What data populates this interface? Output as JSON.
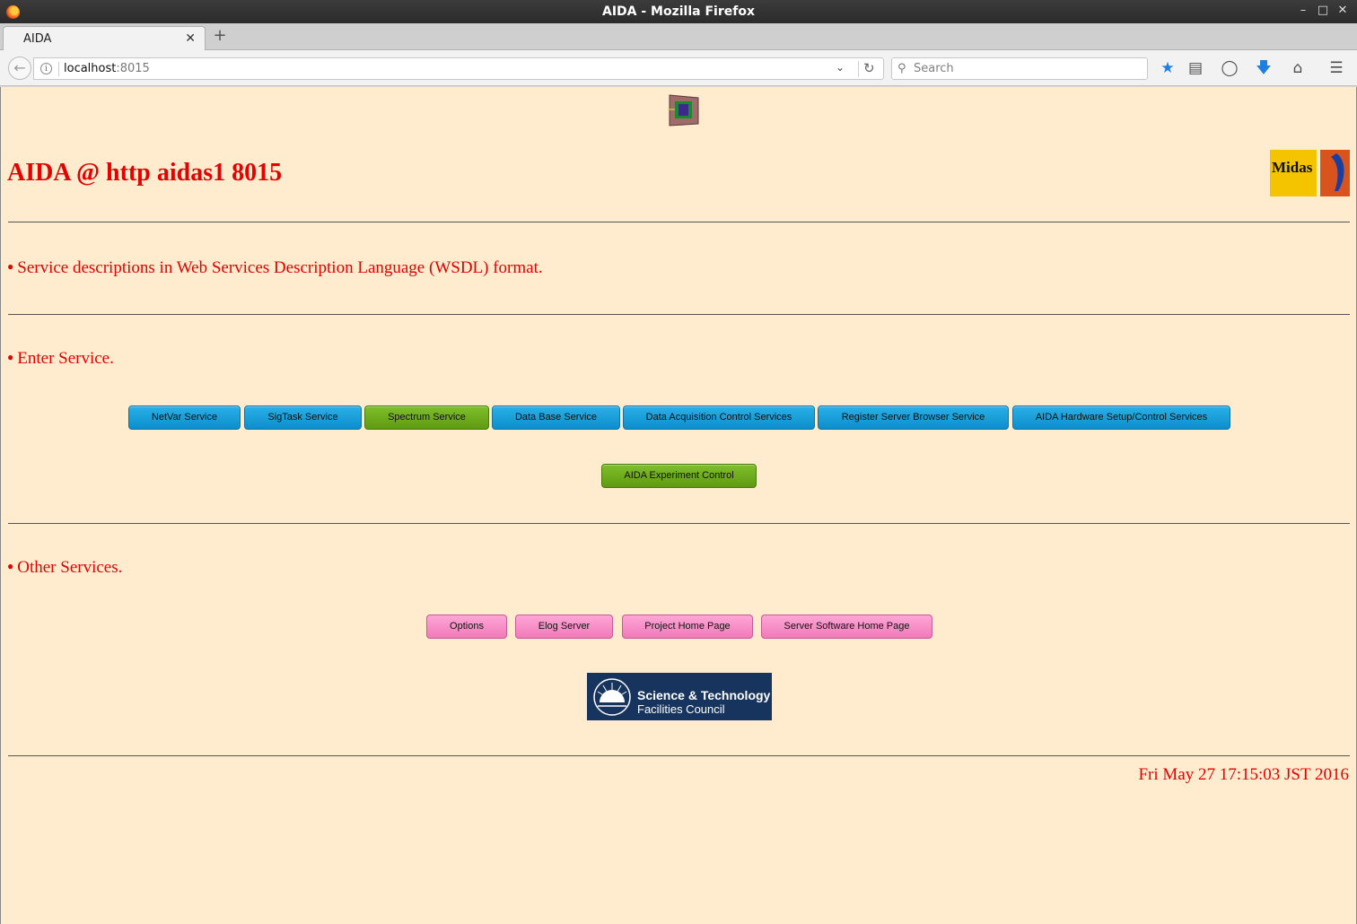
{
  "window": {
    "title": "AIDA - Mozilla Firefox"
  },
  "tabs": [
    {
      "label": "AIDA"
    }
  ],
  "navbar": {
    "url_host": "localhost",
    "url_port": ":8015",
    "search_placeholder": "Search"
  },
  "page": {
    "heading": "AIDA @ http aidas1 8015",
    "wsdl_line": "Service descriptions in Web Services Description Language (WSDL) format.",
    "enter_service": "Enter Service.",
    "services": [
      {
        "label": "NetVar Service",
        "color": "#0b8fcb"
      },
      {
        "label": "SigTask Service",
        "color": "#0b8fcb"
      },
      {
        "label": "Spectrum Service",
        "color": "#5f9a12"
      },
      {
        "label": "Data Base Service",
        "color": "#0b8fcb"
      },
      {
        "label": "Data Acquisition Control Services",
        "color": "#0b8fcb"
      },
      {
        "label": "Register Server Browser Service",
        "color": "#0b8fcb"
      },
      {
        "label": "AIDA Hardware Setup/Control Services",
        "color": "#0b8fcb"
      }
    ],
    "experiment_control": "AIDA Experiment Control",
    "other_services_title": "Other Services.",
    "other_services": [
      {
        "label": "Options"
      },
      {
        "label": "Elog Server"
      },
      {
        "label": "Project Home Page"
      },
      {
        "label": "Server Software Home Page"
      }
    ],
    "midas_logo_text": "Midas",
    "stfc_line1": "Science & Technology",
    "stfc_line2": "Facilities Council",
    "datetime": "Fri May 27 17:15:03 JST 2016"
  },
  "colors": {
    "page_bg": "#ffebcd",
    "text_red": "#e60000",
    "pink_button": "#f07ab9"
  }
}
